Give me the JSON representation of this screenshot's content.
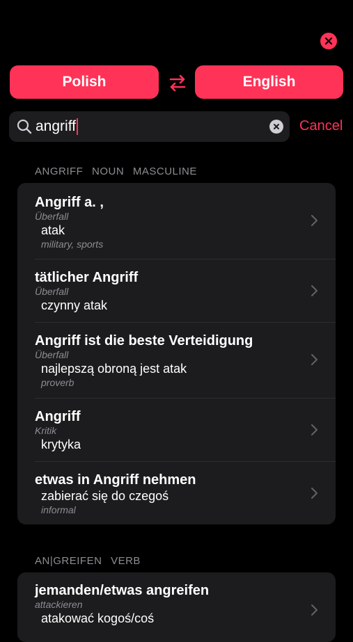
{
  "languages": {
    "from": "Polish",
    "to": "English"
  },
  "search": {
    "query": "angriff",
    "cancel_label": "Cancel"
  },
  "sections": [
    {
      "header": [
        "ANGRIFF",
        "NOUN",
        "MASCULINE"
      ],
      "entries": [
        {
          "title": "Angriff a. ,",
          "gloss": "Überfall",
          "translation": "atak",
          "note": "military, sports"
        },
        {
          "title": "tätlicher Angriff",
          "gloss": "Überfall",
          "translation": "czynny atak",
          "note": ""
        },
        {
          "title": "Angriff ist die beste Verteidigung",
          "gloss": "Überfall",
          "translation": "najlepszą obroną jest atak",
          "note": "proverb"
        },
        {
          "title": "Angriff",
          "gloss": "Kritik",
          "translation": "krytyka",
          "note": ""
        },
        {
          "title": "etwas in Angriff nehmen",
          "gloss": "",
          "translation": "zabierać się do czegoś",
          "note": "informal"
        }
      ]
    },
    {
      "header": [
        "AN|GREIFEN",
        "VERB"
      ],
      "entries": [
        {
          "title": "jemanden/etwas angreifen",
          "gloss": "attackieren",
          "translation": "atakować kogoś/coś",
          "note": ""
        }
      ]
    }
  ],
  "colors": {
    "accent": "#ff3358",
    "card": "#1c1c1e",
    "muted": "#8e8e93"
  },
  "icons": {
    "close": "close-icon",
    "swap": "swap-arrows-icon",
    "search": "search-icon",
    "clear": "clear-icon",
    "chevron": "chevron-right-icon"
  }
}
